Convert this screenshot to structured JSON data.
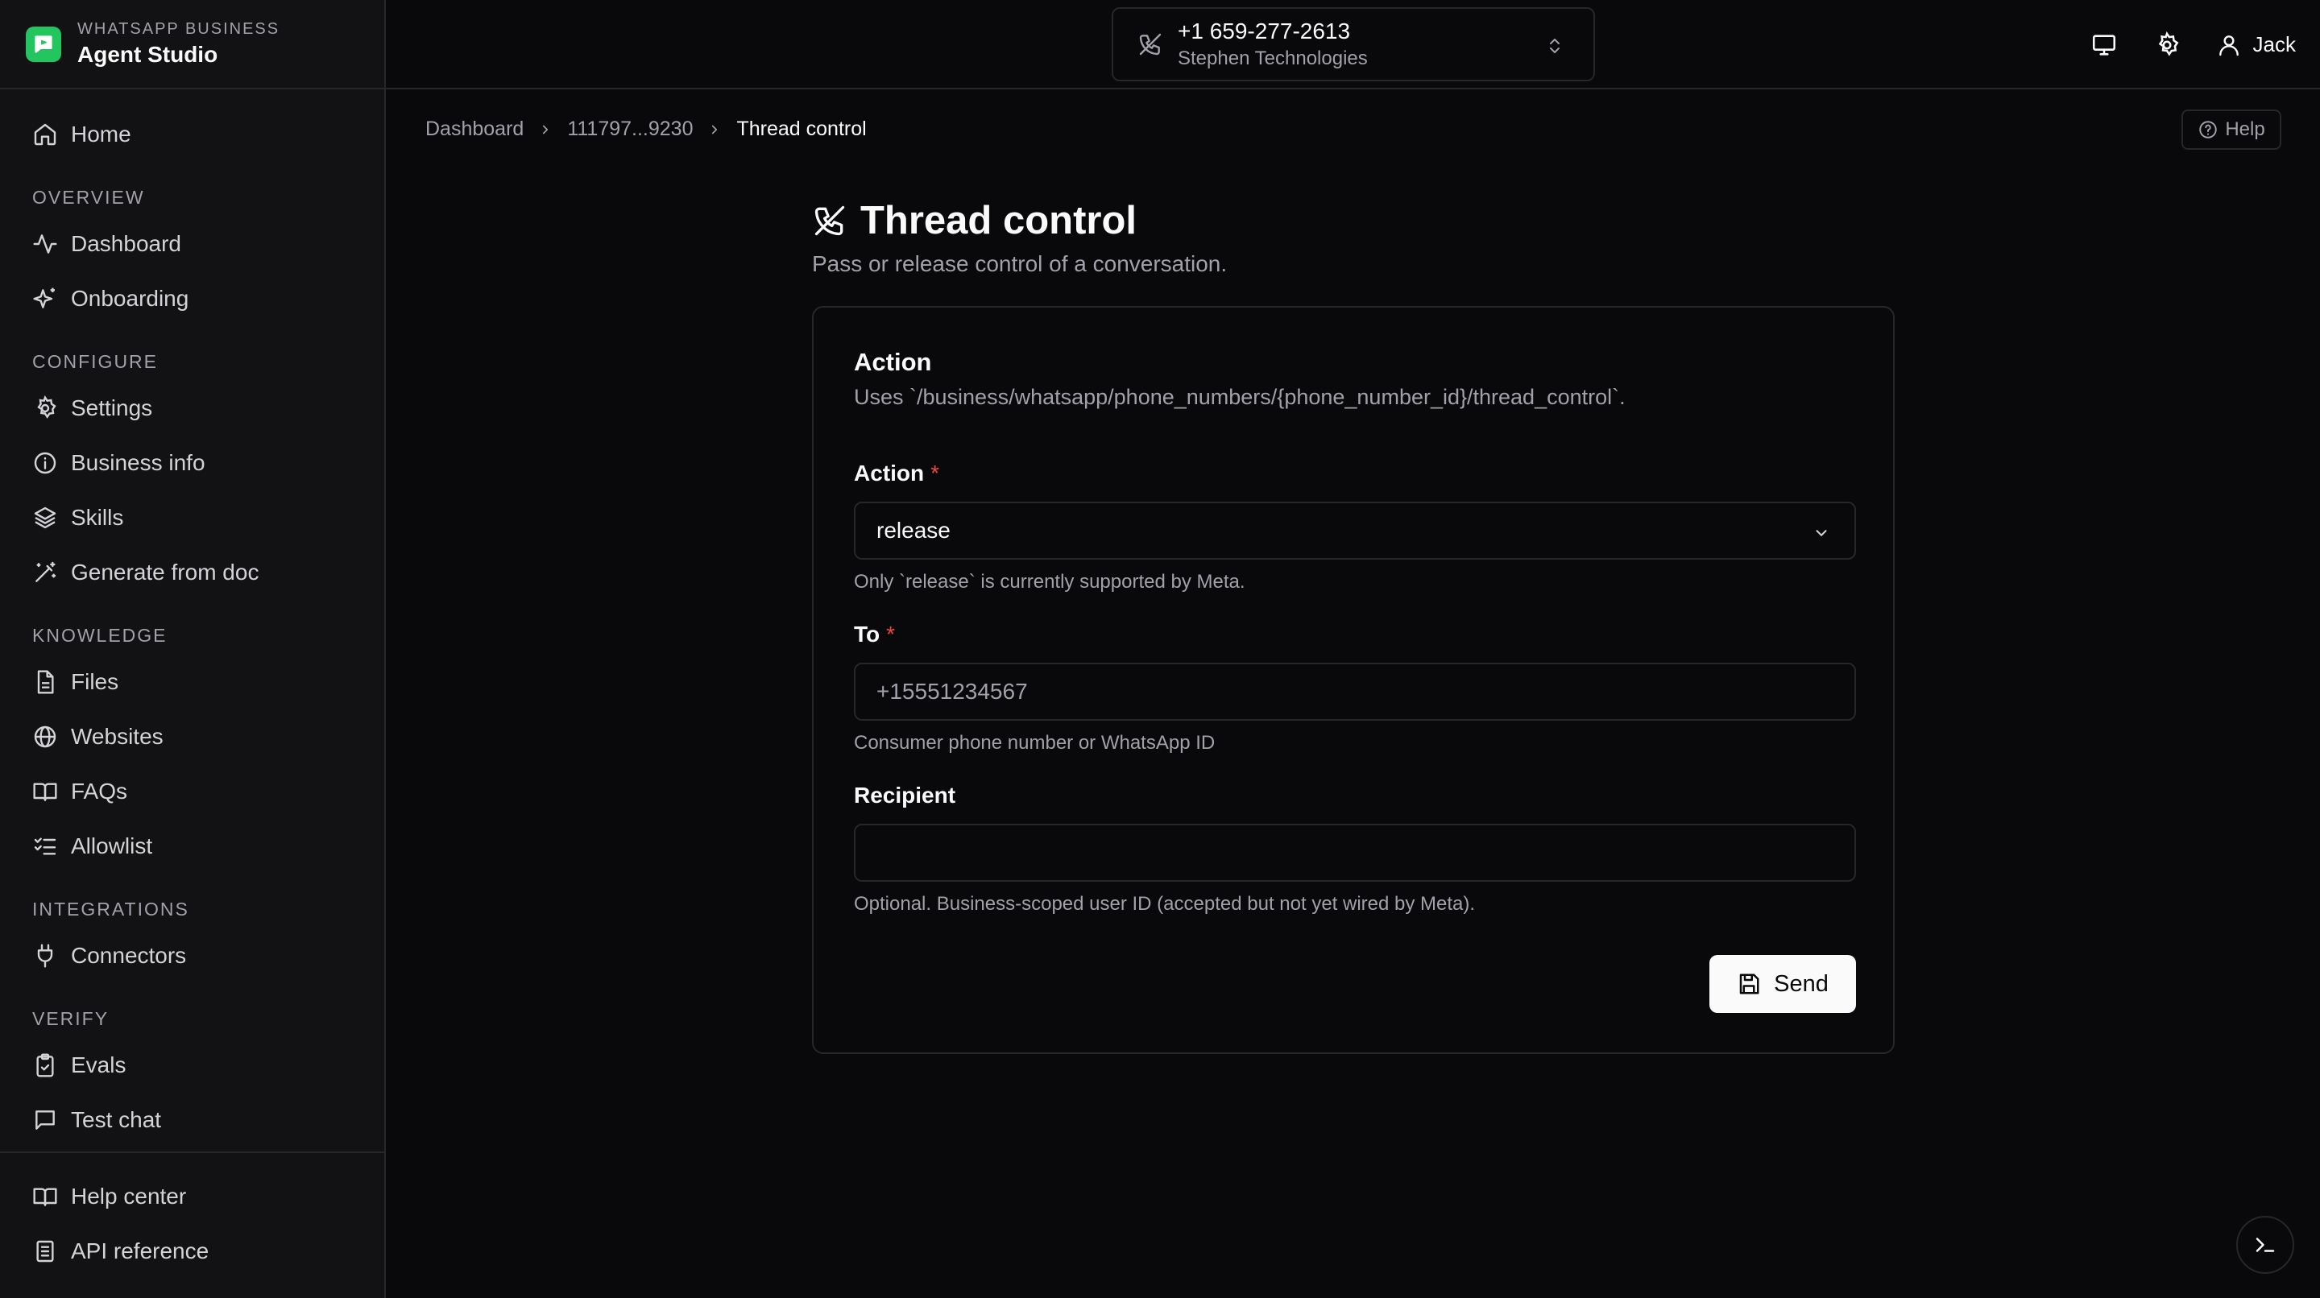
{
  "brand": {
    "subtitle": "WHATSAPP BUSINESS",
    "title": "Agent Studio",
    "color": "#22c55e"
  },
  "sidebar": {
    "home": "Home",
    "sections": {
      "overview": "OVERVIEW",
      "configure": "CONFIGURE",
      "knowledge": "KNOWLEDGE",
      "integrations": "INTEGRATIONS",
      "verify": "VERIFY"
    },
    "items": {
      "dashboard": "Dashboard",
      "onboarding": "Onboarding",
      "settings": "Settings",
      "business_info": "Business info",
      "skills": "Skills",
      "generate_from_doc": "Generate from doc",
      "files": "Files",
      "websites": "Websites",
      "faqs": "FAQs",
      "allowlist": "Allowlist",
      "connectors": "Connectors",
      "evals": "Evals",
      "test_chat": "Test chat"
    },
    "footer": {
      "help_center": "Help center",
      "api_reference": "API reference"
    }
  },
  "topbar": {
    "phone_number": "+1 659-277-2613",
    "company": "Stephen Technologies",
    "user": "Jack"
  },
  "breadcrumb": {
    "root": "Dashboard",
    "middle": "111797...9230",
    "current": "Thread control"
  },
  "help_label": "Help",
  "page": {
    "title": "Thread control",
    "description": "Pass or release control of a conversation."
  },
  "card": {
    "title": "Action",
    "description": "Uses `/business/whatsapp/phone_numbers/{phone_number_id}/thread_control`.",
    "fields": {
      "action": {
        "label": "Action",
        "required_mark": "*",
        "value": "release",
        "help": "Only `release` is currently supported by Meta."
      },
      "to": {
        "label": "To",
        "required_mark": "*",
        "placeholder": "+15551234567",
        "help": "Consumer phone number or WhatsApp ID"
      },
      "recipient": {
        "label": "Recipient",
        "placeholder": "",
        "help": "Optional. Business-scoped user ID (accepted but not yet wired by Meta)."
      }
    },
    "send_label": "Send"
  },
  "colors": {
    "background": "#09090b",
    "sidebar": "#121214",
    "border": "#27272a",
    "muted_text": "#a1a1aa",
    "required": "#ef4444",
    "primary_button": "#fafafa"
  }
}
